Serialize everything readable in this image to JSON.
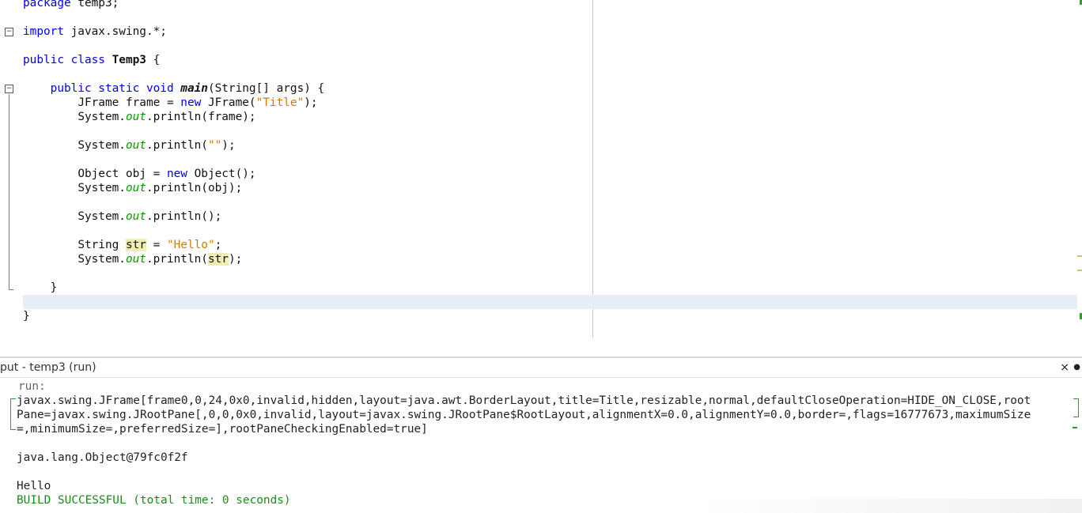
{
  "editor": {
    "lines": {
      "l1": {
        "kw": "package",
        "rest": " temp3;"
      },
      "l2": {
        "kw": "import",
        "rest": " javax.swing.*;"
      },
      "l3": {
        "kw": "public class",
        "sp": " ",
        "name": "Temp3",
        "rest": " {"
      },
      "l4": {
        "indent": "    ",
        "kw": "public static void",
        "sp": " ",
        "name": "main",
        "rest": "(String[] args) {"
      },
      "l5": {
        "indent": "        ",
        "a": "JFrame frame = ",
        "kw": "new",
        "b": " JFrame(",
        "str": "\"Title\"",
        "c": ");"
      },
      "l6": {
        "indent": "        ",
        "a": "System.",
        "fld": "out",
        "b": ".println(frame);"
      },
      "l7": {
        "indent": "        ",
        "a": "System.",
        "fld": "out",
        "b": ".println(",
        "str": "\"\"",
        "c": ");"
      },
      "l8": {
        "indent": "        ",
        "a": "Object obj = ",
        "kw": "new",
        "b": " Object();"
      },
      "l9": {
        "indent": "        ",
        "a": "System.",
        "fld": "out",
        "b": ".println(obj);"
      },
      "l10": {
        "indent": "        ",
        "a": "System.",
        "fld": "out",
        "b": ".println();"
      },
      "l11": {
        "indent": "        ",
        "a": "String ",
        "hl": "str",
        "b": " = ",
        "str": "\"Hello\"",
        "c": ";"
      },
      "l12": {
        "indent": "        ",
        "a": "System.",
        "fld": "out",
        "b": ".println(",
        "hl": "str",
        "c": ");"
      },
      "l13": {
        "indent": "    ",
        "a": "}"
      },
      "l14": {
        "a": "}"
      }
    },
    "fold_symbol": "−"
  },
  "output_panel": {
    "tab_title": "put - temp3 (run)",
    "close_label": "×",
    "dot_label": "●",
    "lines": [
      "run:",
      "javax.swing.JFrame[frame0,0,24,0x0,invalid,hidden,layout=java.awt.BorderLayout,title=Title,resizable,normal,defaultCloseOperation=HIDE_ON_CLOSE,root",
      "Pane=javax.swing.JRootPane[,0,0,0x0,invalid,layout=javax.swing.JRootPane$RootLayout,alignmentX=0.0,alignmentY=0.0,border=,flags=16777673,maximumSize",
      "=,minimumSize=,preferredSize=],rootPaneCheckingEnabled=true]",
      "",
      "java.lang.Object@79fc0f2f",
      "",
      "Hello",
      "BUILD SUCCESSFUL (total time: 0 seconds)"
    ]
  },
  "colors": {
    "keyword": "#0000e6",
    "string": "#ce7b00",
    "static_field": "#009900",
    "highlight": "#efedb2",
    "success": "#1c8a1c"
  }
}
